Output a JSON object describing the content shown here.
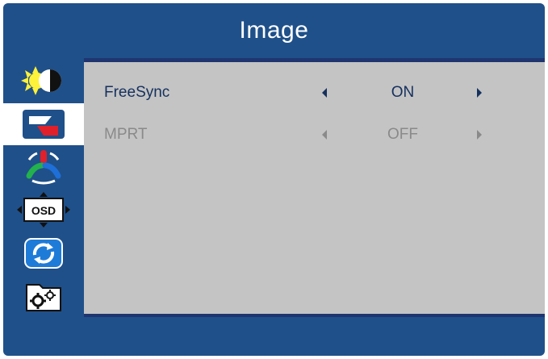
{
  "header": {
    "title": "Image"
  },
  "sidebar": {
    "items": [
      {
        "icon": "brightness-contrast-icon"
      },
      {
        "icon": "image-icon",
        "selected": true
      },
      {
        "icon": "color-icon"
      },
      {
        "icon": "osd-icon",
        "osd_text": "OSD"
      },
      {
        "icon": "reset-icon"
      },
      {
        "icon": "settings-icon"
      }
    ]
  },
  "settings": [
    {
      "label": "FreeSync",
      "value": "ON",
      "enabled": true
    },
    {
      "label": "MPRT",
      "value": "OFF",
      "enabled": false
    }
  ],
  "colors": {
    "frame": "#1f5089",
    "content_bg": "#c4c4c4",
    "active_text": "#15305e",
    "disabled_text": "#8a8a8a"
  }
}
